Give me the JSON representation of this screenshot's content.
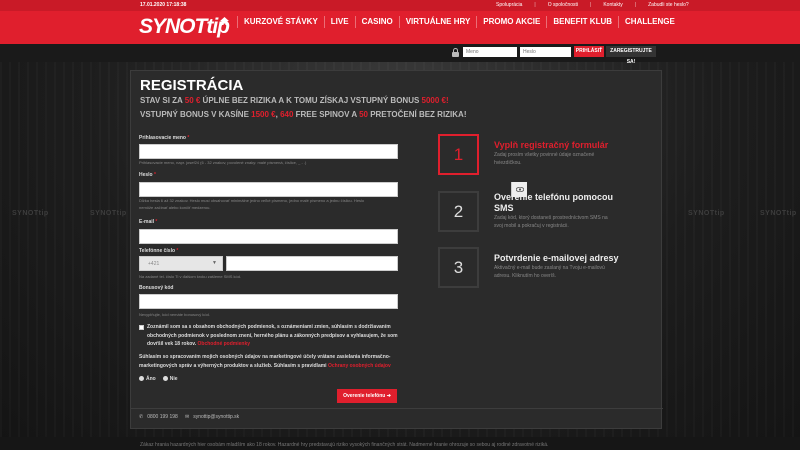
{
  "topbar": {
    "datetime": "17.01.2020 17:18:38",
    "links": [
      "Spoluprácia",
      "O spoločnosti",
      "Kontakty",
      "Zabudli ste heslo?"
    ]
  },
  "brand": {
    "logo": "SYNOTtip",
    "accent": "#e01f2d"
  },
  "nav": {
    "home_icon": "home-icon",
    "items": [
      "KURZOVÉ STÁVKY",
      "LIVE",
      "CASINO",
      "VIRTUÁLNE HRY",
      "PROMO AKCIE",
      "BENEFIT KLUB",
      "CHALLENGE"
    ]
  },
  "login": {
    "username_placeholder": "Meno",
    "password_placeholder": "Heslo",
    "login_button": "PRIHLÁSIŤ",
    "register_button": "ZAREGISTRUJTE SA!"
  },
  "registration": {
    "title": "REGISTRÁCIA",
    "promo_line1": {
      "a": "STAV SI ZA ",
      "b": "50 €",
      "c": " ÚPLNE BEZ RIZIKA A K TOMU ZÍSKAJ VSTUPNÝ BONUS ",
      "d": "5000 €!"
    },
    "promo_line2": {
      "a": "VSTUPNÝ BONUS V KASÍNE ",
      "b": "1500 €",
      "c": ", ",
      "d": "640",
      "e": " FREE SPINOV A ",
      "f": "50",
      "g": " PRETOČENÍ BEZ RIZIKA!"
    },
    "fields": {
      "username": {
        "label": "Prihlasovacie meno",
        "required": "*",
        "hint": "Prihlasovacie meno, napr. josef24 (6 - 32 znakov, povolené znaky: malé písmená, číslice, _ - .)"
      },
      "password": {
        "label": "Heslo",
        "required": "*",
        "hint1": "Dĺžka hesla 6 až 32 znakov. Heslo musí obsahovať minimálne jedno veľké písmeno, jedno malé písmeno a jednu číslicu. Heslo",
        "hint2": "nemôže začínať alebo končiť medzerou."
      },
      "email": {
        "label": "E-mail",
        "required": "*"
      },
      "phone": {
        "label": "Telefónne číslo",
        "required": "*",
        "prefix": "+421",
        "hint": "Na zadané tel. číslo Ti v ďalšom kroku zašleme SMS kód."
      },
      "bonus": {
        "label": "Bonusový kód",
        "hint": "Nevyplňujte, kód nemáte bonusový kód."
      }
    },
    "terms": {
      "line1": "Zoznámil som sa s obsahom obchodných podmienok, s oznámeniami zmien, súhlasím s dodržiavaním",
      "line2": "obchodných podmienok v poslednom znení, herného plánu a zákonných predpisov a vyhlasujem, že som",
      "line3a": "dovŕšil vek 18 rokov. ",
      "line3b": "Obchodné podmienky"
    },
    "marketing": {
      "line1": "Súhlasím so spracovaním mojich osobných údajov na marketingové účely vrátane zasielania informačno-",
      "line2a": "marketingových správ a výherných produktov a služieb. Súhlasím s pravidlami ",
      "line2b": "Ochrany osobných údajov"
    },
    "options": {
      "yes": "Áno",
      "no": "Nie"
    },
    "submit": "Overenie telefónu",
    "contact": {
      "phone": "0800 199 198",
      "email": "synottip@synottip.sk"
    }
  },
  "steps": [
    {
      "number": "1",
      "title": "Vyplň registračný formulár",
      "desc": "Zadaj prosím všetky povinné údaje označené hviezdičkou."
    },
    {
      "number": "2",
      "title": "Overenie telefónu pomocou SMS",
      "desc": "Zadaj kód, ktorý dostaneš prostredníctvom SMS na svoj mobil a pokračuj v registrácii."
    },
    {
      "number": "3",
      "title": "Potvrdenie e-mailovej adresy",
      "desc": "Aktivačný e-mail bude zaslaný na Tvoju e-mailovú adresu. Kliknutím ho overíš."
    }
  ],
  "footer": {
    "text": "Zákaz hrania hazardných hier osobám mladším ako 18 rokov. Hazardné hry predstavujú riziko vysokých finančných strát. Nadmerné hranie ohrozuje so sebou aj rodiné zdravotné riziká."
  }
}
